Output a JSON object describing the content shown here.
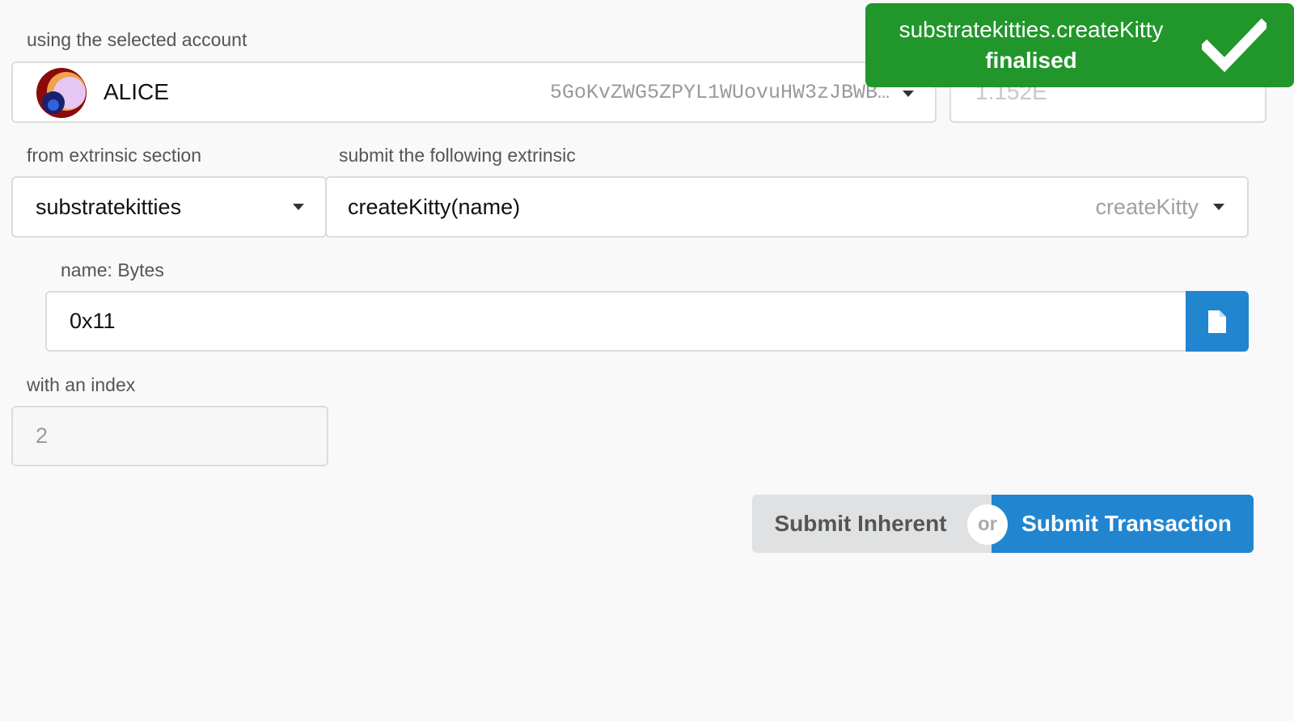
{
  "account": {
    "label": "using the selected account",
    "name": "ALICE",
    "address": "5GoKvZWG5ZPYL1WUovuHW3zJBWB…",
    "balance": "1.152E"
  },
  "extrinsic": {
    "section_label": "from extrinsic section",
    "section_value": "substratekitties",
    "method_label": "submit the following extrinsic",
    "method_value": "createKitty(name)",
    "method_hint": "createKitty"
  },
  "param": {
    "label": "name: Bytes",
    "value": "0x11"
  },
  "index": {
    "label": "with an index",
    "value": "2"
  },
  "buttons": {
    "inherent": "Submit Inherent",
    "or": "or",
    "transaction": "Submit Transaction"
  },
  "toast": {
    "title": "substratekitties.createKitty",
    "status": "finalised"
  },
  "colors": {
    "primary": "#2185d0",
    "success": "#21962b",
    "secondary": "#e0e1e2"
  },
  "icons": {
    "doc": "file-icon",
    "check": "checkmark-icon",
    "caret": "chevron-down-icon"
  }
}
